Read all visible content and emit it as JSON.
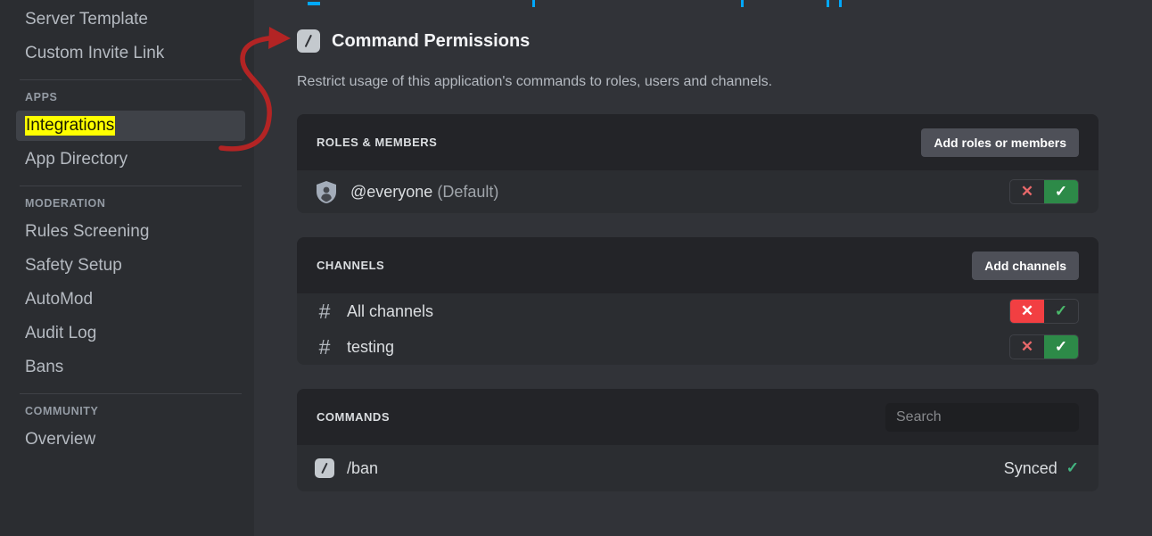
{
  "sidebar": {
    "groups": [
      {
        "header": null,
        "items": [
          {
            "label": "Server Template",
            "state": "normal"
          },
          {
            "label": "Custom Invite Link",
            "state": "normal"
          }
        ]
      },
      {
        "header": "APPS",
        "items": [
          {
            "label": "Integrations",
            "state": "active-highlighted"
          },
          {
            "label": "App Directory",
            "state": "normal"
          }
        ]
      },
      {
        "header": "MODERATION",
        "items": [
          {
            "label": "Rules Screening",
            "state": "normal"
          },
          {
            "label": "Safety Setup",
            "state": "normal"
          },
          {
            "label": "AutoMod",
            "state": "normal"
          },
          {
            "label": "Audit Log",
            "state": "normal"
          },
          {
            "label": "Bans",
            "state": "normal"
          }
        ]
      },
      {
        "header": "COMMUNITY",
        "items": [
          {
            "label": "Overview",
            "state": "normal"
          }
        ]
      }
    ]
  },
  "page": {
    "title": "Command Permissions",
    "description": "Restrict usage of this application's commands to roles, users and channels.",
    "icon": "slash-command-icon"
  },
  "roles_members": {
    "header": "ROLES & MEMBERS",
    "add_button": "Add roles or members",
    "rows": [
      {
        "name": "@everyone",
        "suffix": "(Default)",
        "icon": "shield-person-icon",
        "deny_label": "✕",
        "allow_label": "✓",
        "selected": "allow"
      }
    ]
  },
  "channels": {
    "header": "CHANNELS",
    "add_button": "Add channels",
    "rows": [
      {
        "name": "All channels",
        "icon": "hash-icon",
        "deny_label": "✕",
        "allow_label": "✓",
        "selected": "deny"
      },
      {
        "name": "testing",
        "icon": "hash-icon",
        "deny_label": "✕",
        "allow_label": "✓",
        "selected": "allow"
      }
    ]
  },
  "commands": {
    "header": "COMMANDS",
    "search_placeholder": "Search",
    "search_value": "",
    "search_icon": "magnifier-icon",
    "rows": [
      {
        "name": "/ban",
        "icon": "slash-command-icon",
        "status": "Synced",
        "status_check": "✓"
      }
    ]
  },
  "annotation": {
    "arrow_color": "#b32424",
    "highlight_color": "#ffff00",
    "arrow_name": "red-callout-arrow"
  },
  "colors": {
    "sidebar_bg": "#2b2d31",
    "main_bg": "#313338",
    "card_bg": "#2b2d31",
    "card_header_bg": "#232428",
    "accent_green": "#2d8a48",
    "accent_red": "#f23f42",
    "link_blue": "#00a8fc"
  }
}
